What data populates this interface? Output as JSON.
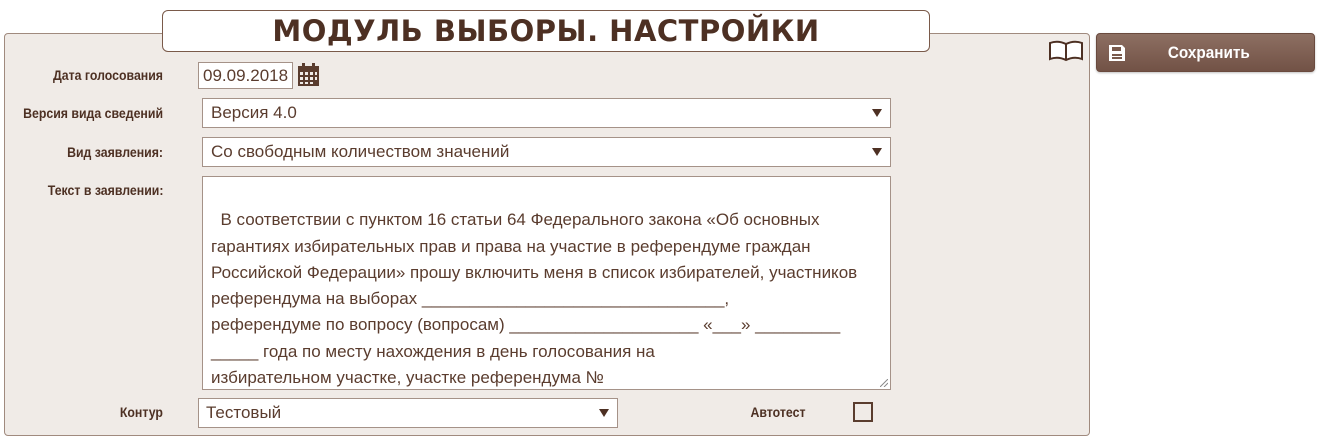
{
  "header": {
    "title": "МОДУЛЬ ВЫБОРЫ. НАСТРОЙКИ"
  },
  "toolbar": {
    "save_label": "Сохранить",
    "save_icon": "save-icon",
    "help_icon": "book-icon"
  },
  "form": {
    "vote_date": {
      "label": "Дата голосования",
      "value": "09.09.2018",
      "icon": "calendar-icon"
    },
    "info_version": {
      "label": "Версия вида сведений",
      "value": "Версия 4.0"
    },
    "statement_type": {
      "label": "Вид заявления:",
      "value": "Со свободным количеством значений"
    },
    "statement_text": {
      "label": "Текст в заявлении:",
      "value": "В соответствии с пунктом 16 статьи 64 Федерального закона «Об основных\nгарантиях избирательных прав и права на участие в референдуме граждан\nРоссийской Федерации» прошу включить меня в список избирателей, участников\nреферендума на выборах ________________________________,\nреферендуме по вопросу (вопросам) ____________________ «___» _________\n_____ года по месту нахождения в день голосования на\nизбирательном участке, участке референдума №"
    },
    "contour": {
      "label": "Контур",
      "value": "Тестовый"
    },
    "autotest": {
      "label": "Автотест",
      "checked": false
    }
  },
  "colors": {
    "accent": "#7a5a4c",
    "panel_bg": "#f0ebe7",
    "text": "#4d3023"
  }
}
